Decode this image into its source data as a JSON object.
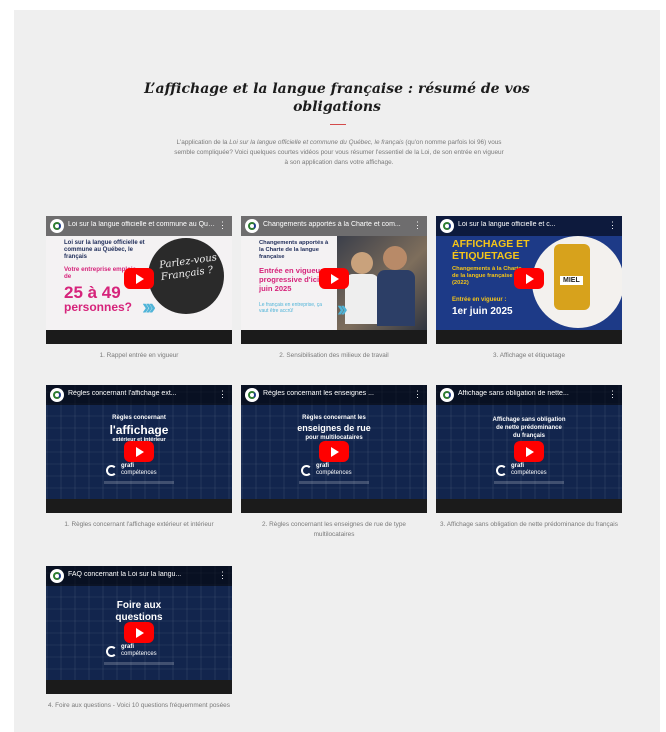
{
  "section": {
    "title_line1": "L’affichage et la langue française : résumé de vos",
    "title_line2": "obligations",
    "intro_prefix": "L'application de la ",
    "intro_law": "Loi sur la langue officielle et commune du Québec, le français",
    "intro_suffix": " (qu'on nomme parfois loi 96) vous semble compliquée? Voici quelques courtes vidéos pour vous résumer l'essentiel de la Loi, de son entrée en vigueur à son application dans votre affichage."
  },
  "colors": {
    "accent": "#d34a4a",
    "play": "#ff0000",
    "pink": "#d6247b",
    "navy": "#12254d",
    "yellow": "#f5c518"
  },
  "videos": [
    {
      "title": "Loi sur la langue officielle et commune au Québec, le français",
      "caption": "1. Rappel entrée en vigueur",
      "thumb": {
        "line1": "Loi sur la langue officielle et commune au Québec, le français",
        "line2": "Votre entreprise emploie de",
        "big": "25 à 49",
        "big2": "personnes?",
        "bubble": "Parlez-vous Français ?"
      }
    },
    {
      "title": "Changements apportés à la Charte et com...",
      "caption": "2. Sensibilisation des milieux de travail",
      "thumb": {
        "line1": "Changements apportés à la Charte de la langue française",
        "line2": "Entrée en vigueur progressive d'ici juin 2025",
        "line3": "Le français en entreprise, ça vaut être accrû!"
      }
    },
    {
      "title": "Loi sur la langue officielle et c...",
      "caption": "3. Affichage et étiquetage",
      "thumb": {
        "heading": "AFFICHAGE ET ÉTIQUETAGE",
        "sub": "Changements à la Charte de la langue française (2022)",
        "entry": "Entrée en vigueur :",
        "date": "1er juin 2025",
        "jar": "MIEL"
      }
    },
    {
      "title": "Règles concernant l'affichage ext...",
      "caption": "1. Règles concernant l'affichage extérieur et intérieur",
      "thumb": {
        "l1": "Règles concernant",
        "l2": "l'affichage",
        "l3": "extérieur et intérieur"
      }
    },
    {
      "title": "Règles concernant les enseignes ...",
      "caption": "2. Règles concernant les enseignes de rue de type multilocataires",
      "thumb": {
        "l1": "Règles concernant les",
        "l2": "enseignes de rue",
        "l3": "pour multilocataires"
      }
    },
    {
      "title": "Affichage sans obligation de nette...",
      "caption": "3. Affichage sans obligation de nette prédominance du français",
      "thumb": {
        "l1": "Affichage sans obligation",
        "l2": "de nette prédominance",
        "l3": "du français"
      }
    },
    {
      "title": "FAQ concernant la Loi sur la langu...",
      "caption": "4. Foire aux questions - Voici 10 questions fréquemment posées",
      "thumb": {
        "l1": "Foire aux",
        "l2": "questions"
      }
    }
  ],
  "brand": {
    "w1": "grafi",
    "w2": "compétences"
  },
  "icons": {
    "play": "youtube-play-icon",
    "menu": "more-vert-icon",
    "channel": "channel-logo-icon"
  }
}
